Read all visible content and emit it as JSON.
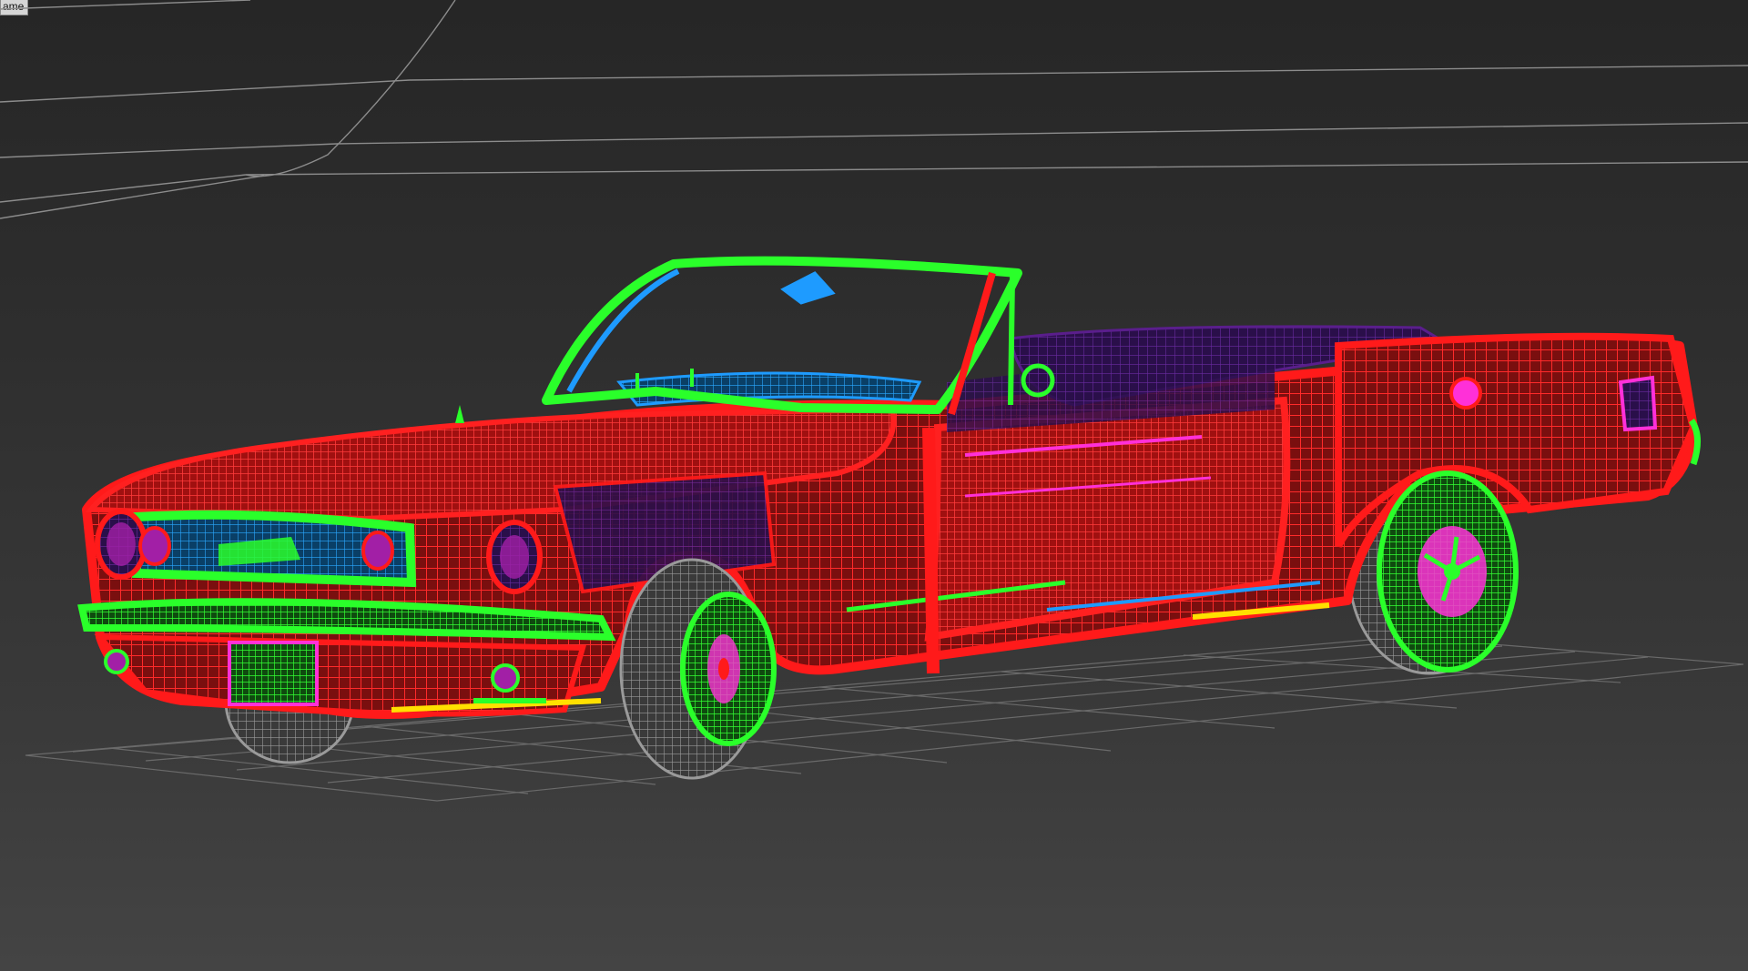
{
  "viewport": {
    "label": "ame",
    "background": "#2e2e2e"
  },
  "colors": {
    "body_wire": "#ff1a1a",
    "trim_wire": "#2aff2a",
    "glass_wire": "#1e9bff",
    "interior_wire": "#5a1e8c",
    "detail_wire": "#ff30d8",
    "tire_wire": "#8a8a8a",
    "grid_wire": "#6a6a6a",
    "accent_wire": "#ffe000"
  },
  "model": {
    "name_icon": "convertible-car-wireframe-icon"
  }
}
